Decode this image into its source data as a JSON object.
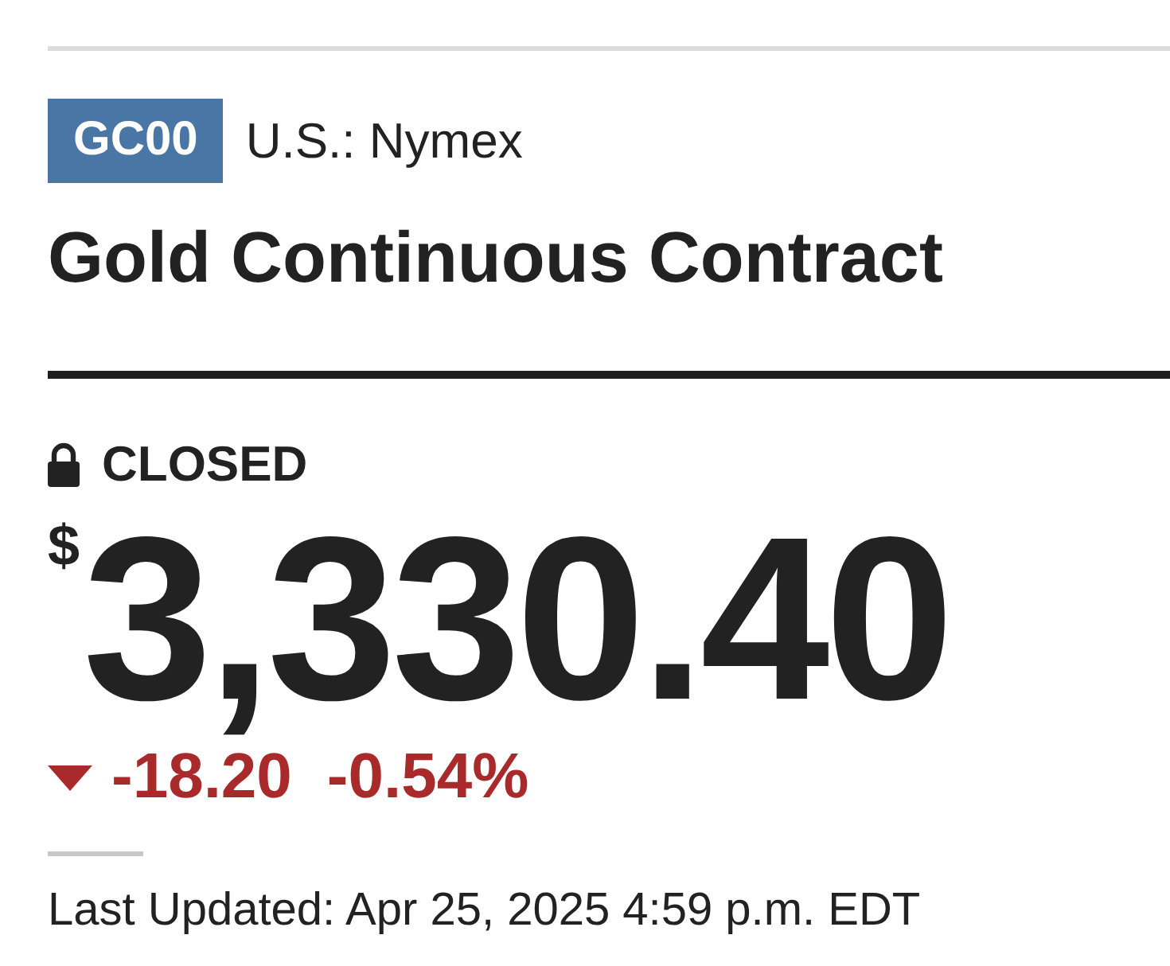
{
  "quote": {
    "symbol": "GC00",
    "exchange": "U.S.: Nymex",
    "name": "Gold Continuous Contract",
    "market_status": "CLOSED",
    "currency": "$",
    "price": "3,330.40",
    "change": {
      "falling": true,
      "points": "-18.20",
      "percent": "-0.54%"
    },
    "last_updated": "Last Updated: Apr 25, 2025 4:59 p.m. EDT"
  }
}
